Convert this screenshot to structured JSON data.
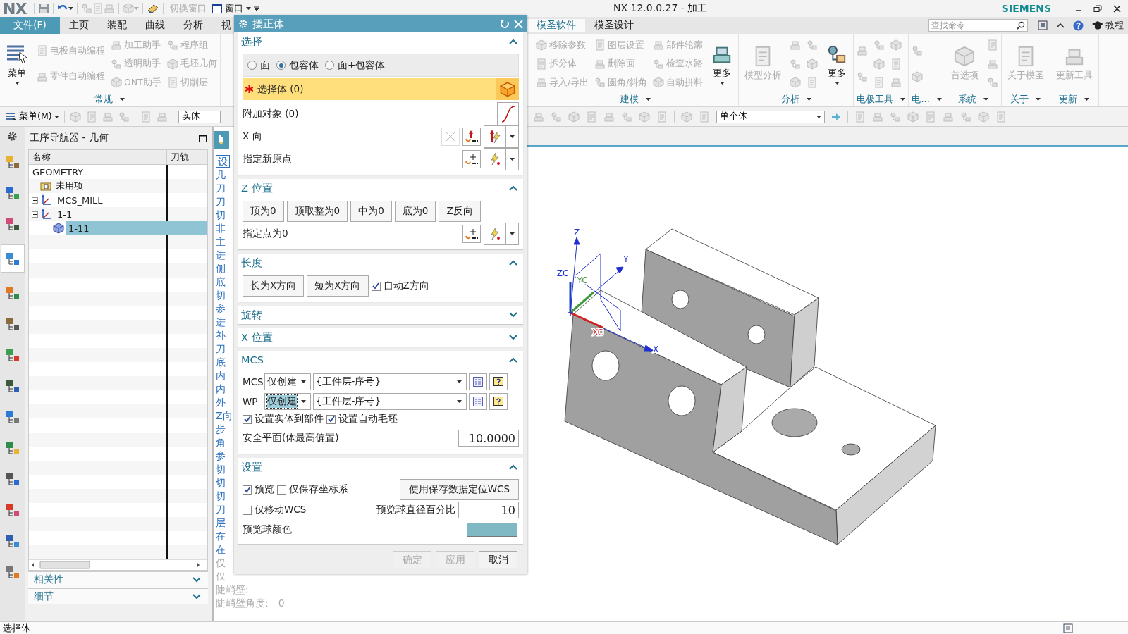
{
  "title_bar": {
    "logo": "NX",
    "quick_access": [
      {
        "label": "切换窗口",
        "disabled": true
      },
      {
        "label": "窗口",
        "disabled": false
      }
    ],
    "title": "NX 12.0.0.27 - 加工",
    "brand": "SIEMENS"
  },
  "ribbon": {
    "tabs": [
      {
        "label": "文件(F)",
        "kind": "file",
        "selected": false
      },
      {
        "label": "主页",
        "kind": "tab",
        "selected": false
      },
      {
        "label": "装配",
        "kind": "tab",
        "selected": false
      },
      {
        "label": "曲线",
        "kind": "tab",
        "selected": false
      },
      {
        "label": "分析",
        "kind": "tab",
        "selected": false
      },
      {
        "label": "视",
        "kind": "tab",
        "selected": false
      },
      {
        "label": "模圣软件",
        "kind": "tab",
        "selected": true
      },
      {
        "label": "模圣设计",
        "kind": "tab",
        "selected": false
      }
    ],
    "search": {
      "placeholder": "查找命令"
    },
    "help_label": "教程",
    "left_groups": [
      {
        "label": "常规",
        "columns": [
          [
            {
              "kind": "big",
              "label": "菜单",
              "disabled": false
            }
          ],
          [
            {
              "kind": "small",
              "label": "电极自动编程",
              "disabled": true
            },
            {
              "kind": "small",
              "label": "零件自动编程",
              "disabled": true
            }
          ],
          [
            {
              "kind": "small",
              "label": "加工助手",
              "disabled": true
            },
            {
              "kind": "small",
              "label": "透明助手",
              "disabled": true
            },
            {
              "kind": "small",
              "label": "ONT助手",
              "disabled": true
            }
          ],
          [
            {
              "kind": "small",
              "label": "程序组",
              "disabled": true
            },
            {
              "kind": "small",
              "label": "毛坯几何",
              "disabled": true
            },
            {
              "kind": "small",
              "label": "切削层",
              "disabled": true
            }
          ]
        ]
      }
    ],
    "right_groups": [
      {
        "label": "建模",
        "columns": [
          [
            {
              "kind": "small",
              "label": "移除参数",
              "disabled": true
            },
            {
              "kind": "small",
              "label": "拆分体",
              "disabled": true
            },
            {
              "kind": "small",
              "label": "导入/导出",
              "disabled": true
            }
          ],
          [
            {
              "kind": "small",
              "label": "图层设置",
              "disabled": true
            },
            {
              "kind": "small",
              "label": "删除面",
              "disabled": true
            },
            {
              "kind": "small",
              "label": "圆角/斜角",
              "disabled": true
            }
          ],
          [
            {
              "kind": "small",
              "label": "部件轮廓",
              "disabled": true
            },
            {
              "kind": "small",
              "label": "检查水路",
              "disabled": true
            },
            {
              "kind": "small",
              "label": "自动拼料",
              "disabled": true
            }
          ],
          [
            {
              "kind": "big",
              "label": "更多",
              "disabled": false
            }
          ]
        ]
      },
      {
        "label": "分析",
        "columns": [
          [
            {
              "kind": "big",
              "label": "模型分析",
              "disabled": true
            }
          ],
          [
            {
              "kind": "icon",
              "disabled": true
            },
            {
              "kind": "icon",
              "disabled": true
            },
            {
              "kind": "icon",
              "disabled": true
            }
          ],
          [
            {
              "kind": "icon",
              "disabled": true
            },
            {
              "kind": "icon",
              "disabled": true
            },
            {
              "kind": "icon",
              "disabled": true
            }
          ],
          [
            {
              "kind": "big",
              "label": "更多",
              "disabled": false
            }
          ]
        ]
      },
      {
        "label": "电极工具",
        "columns": [
          [
            {
              "kind": "icon",
              "disabled": true
            },
            {
              "kind": "icon",
              "disabled": true
            }
          ],
          [
            {
              "kind": "icon",
              "disabled": true
            },
            {
              "kind": "icon",
              "disabled": true
            },
            {
              "kind": "icon",
              "disabled": true
            }
          ],
          [
            {
              "kind": "icon",
              "disabled": true
            },
            {
              "kind": "icon",
              "disabled": true
            },
            {
              "kind": "icon",
              "disabled": true
            }
          ]
        ]
      },
      {
        "label": "电...",
        "columns": [
          [
            {
              "kind": "icon",
              "disabled": true
            },
            {
              "kind": "icon",
              "disabled": true
            }
          ]
        ]
      },
      {
        "label": "系统",
        "columns": [
          [
            {
              "kind": "big",
              "label": "首选项",
              "disabled": true
            }
          ],
          [
            {
              "kind": "icon",
              "disabled": true
            },
            {
              "kind": "icon",
              "disabled": true
            },
            {
              "kind": "icon",
              "disabled": true
            }
          ]
        ]
      },
      {
        "label": "关于",
        "columns": [
          [
            {
              "kind": "big",
              "label": "关于模圣",
              "disabled": true
            }
          ]
        ]
      },
      {
        "label": "更新",
        "columns": [
          [
            {
              "kind": "big",
              "label": "更新工具",
              "disabled": true
            }
          ]
        ]
      }
    ]
  },
  "toolbar": {
    "menu_label": "菜单(M)",
    "filter_value": "实体",
    "type_filter_value": "单个体"
  },
  "resource_bar": {
    "items": [
      {
        "selected": false
      },
      {
        "selected": false
      },
      {
        "selected": false
      },
      {
        "selected": true
      },
      {
        "selected": false
      },
      {
        "selected": false
      },
      {
        "selected": false
      },
      {
        "selected": false
      },
      {
        "selected": false
      },
      {
        "selected": false
      },
      {
        "selected": false
      },
      {
        "selected": false
      },
      {
        "selected": false
      },
      {
        "selected": false
      }
    ]
  },
  "navigator": {
    "title": "工序导航器 - 几何",
    "columns": [
      "名称",
      "刀轨"
    ],
    "tree": [
      {
        "label": "GEOMETRY",
        "selected": false,
        "children": [
          {
            "label": "未用项",
            "kind": "folder",
            "selected": false
          },
          {
            "label": "MCS_MILL",
            "kind": "mcs",
            "expanded": false,
            "selected": false
          },
          {
            "label": "1-1",
            "kind": "mcs",
            "expanded": true,
            "selected": false,
            "children": [
              {
                "label": "1-11",
                "kind": "workpiece",
                "selected": true
              }
            ]
          }
        ]
      }
    ],
    "panels": [
      {
        "label": "相关性",
        "expanded": false
      },
      {
        "label": "细节",
        "expanded": false
      }
    ]
  },
  "op_strip": {
    "items": [
      {
        "label": "设",
        "kind": "box",
        "disabled": false
      },
      {
        "label": "几",
        "disabled": false
      },
      {
        "label": "刀",
        "disabled": false
      },
      {
        "label": "刀",
        "disabled": false
      },
      {
        "label": "切",
        "disabled": false
      },
      {
        "label": "非",
        "disabled": false
      },
      {
        "label": "主",
        "disabled": false
      },
      {
        "label": "进",
        "disabled": false
      },
      {
        "label": "侧",
        "disabled": false
      },
      {
        "label": "底",
        "disabled": false
      },
      {
        "label": "切",
        "disabled": false
      },
      {
        "label": "参",
        "disabled": false
      },
      {
        "label": "进",
        "disabled": false
      },
      {
        "label": "补",
        "disabled": false
      },
      {
        "label": "刀",
        "disabled": false
      },
      {
        "label": "底",
        "disabled": false
      },
      {
        "label": "内",
        "disabled": false
      },
      {
        "label": "内",
        "disabled": false
      },
      {
        "label": "外",
        "disabled": false
      },
      {
        "label": "Z向",
        "disabled": false
      },
      {
        "label": "步",
        "disabled": false
      },
      {
        "label": "角",
        "disabled": false
      },
      {
        "label": "参",
        "disabled": false
      },
      {
        "label": "切",
        "disabled": false
      },
      {
        "label": "切",
        "disabled": false
      },
      {
        "label": "切",
        "disabled": false
      },
      {
        "label": "刀",
        "disabled": false
      },
      {
        "label": "层",
        "disabled": false
      },
      {
        "label": "在",
        "disabled": false
      },
      {
        "label": "在",
        "disabled": false
      },
      {
        "label": "仅",
        "disabled": true
      },
      {
        "label": "仅",
        "disabled": true
      }
    ],
    "notes": [
      {
        "label": "陡峭壁:"
      },
      {
        "label": "陡峭壁角度:",
        "value": "0"
      }
    ]
  },
  "dialog": {
    "title": "摆正体",
    "sections": [
      {
        "title": "选择",
        "expanded": true,
        "kind": "select",
        "radios": [
          {
            "label": "面",
            "selected": false
          },
          {
            "label": "包容体",
            "selected": true
          },
          {
            "label": "面+包容体",
            "selected": false
          }
        ],
        "rows": [
          {
            "label": "选择体 (0)",
            "kind": "body"
          },
          {
            "label": "附加对象 (0)",
            "kind": "curve"
          },
          {
            "label": "X 向",
            "kind": "vector"
          },
          {
            "label": "指定新原点",
            "kind": "point"
          }
        ]
      },
      {
        "title": "Z 位置",
        "expanded": true,
        "kind": "buttons",
        "buttons": [
          "顶为0",
          "顶取整为0",
          "中为0",
          "底为0",
          "Z反向"
        ],
        "rows": [
          {
            "label": "指定点为0",
            "kind": "point"
          }
        ]
      },
      {
        "title": "长度",
        "expanded": true,
        "kind": "buttons",
        "buttons": [
          "长为X方向",
          "短为X方向"
        ],
        "checkbox": {
          "label": "自动Z方向",
          "checked": true
        }
      },
      {
        "title": "旋转",
        "expanded": false
      },
      {
        "title": "X 位置",
        "expanded": false
      },
      {
        "title": "MCS",
        "expanded": true,
        "kind": "mcs",
        "combos": [
          {
            "label": "MCS",
            "mode": "仅创建",
            "name": "{工件层-序号}",
            "focused": false
          },
          {
            "label": "WP",
            "mode": "仅创建",
            "name": "{工件层-序号}",
            "focused": true
          }
        ],
        "checkboxes": [
          {
            "label": "设置实体到部件",
            "checked": true
          },
          {
            "label": "设置自动毛坯",
            "checked": true
          }
        ],
        "value_label": "安全平面(体最高偏置)",
        "value": "10.0000"
      },
      {
        "title": "设置",
        "expanded": true,
        "kind": "settings",
        "preview": {
          "label": "预览",
          "checked": true
        },
        "save_csys": {
          "label": "仅保存坐标系",
          "checked": false
        },
        "wcs_button": "使用保存数据定位WCS",
        "move_wcs": {
          "label": "仅移动WCS",
          "checked": false
        },
        "ball_size_label": "预览球直径百分比",
        "ball_size": "10",
        "ball_color_label": "预览球颜色",
        "color": "#80b8c4"
      }
    ],
    "footer": [
      {
        "label": "确定",
        "disabled": true
      },
      {
        "label": "应用",
        "disabled": true
      },
      {
        "label": "取消",
        "disabled": false
      }
    ]
  },
  "viewport": {
    "triad": [
      {
        "kind": "z",
        "label": "Z"
      },
      {
        "kind": "y",
        "label": "Y"
      },
      {
        "kind": "x",
        "label": "X"
      },
      {
        "kind": "zc",
        "label": "ZC"
      },
      {
        "kind": "yc",
        "label": "YC"
      },
      {
        "kind": "xc",
        "label": "XC"
      }
    ]
  },
  "status_bar": {
    "prompt": "选择体"
  }
}
